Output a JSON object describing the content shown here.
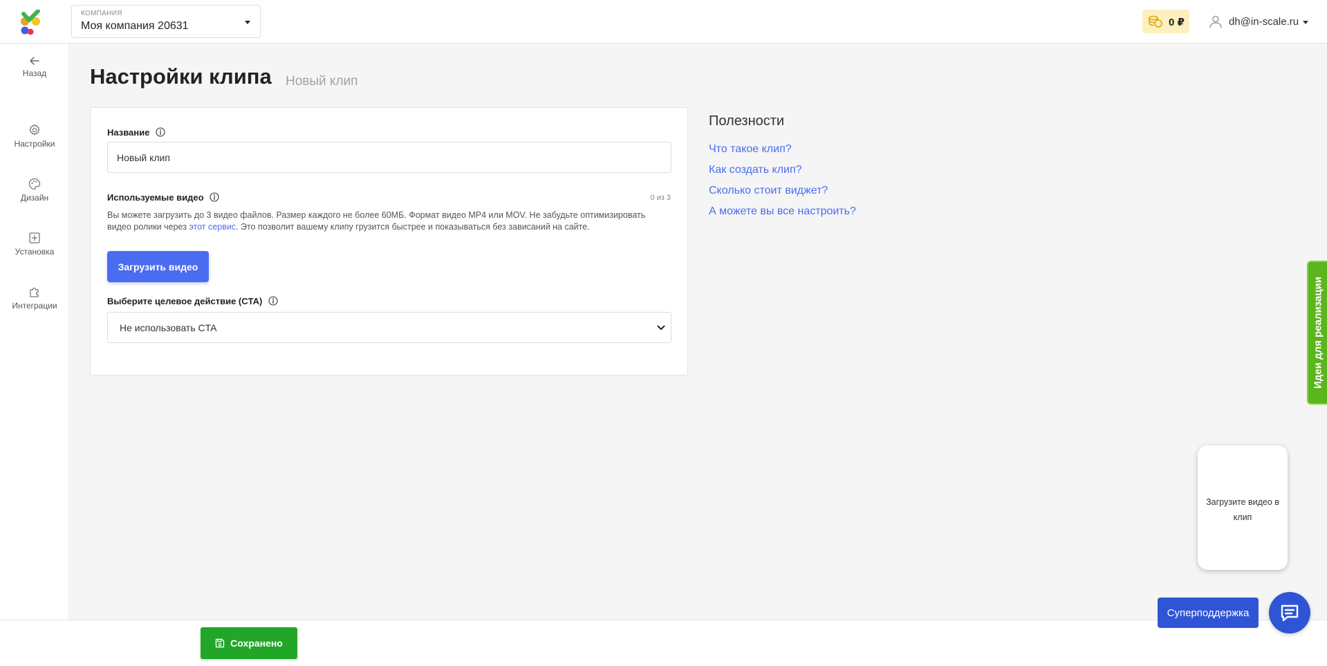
{
  "header": {
    "company_caption": "КОМПАНИЯ",
    "company_name": "Моя компания 20631",
    "balance": "0 ₽",
    "user_email": "dh@in-scale.ru"
  },
  "sidebar": {
    "items": [
      {
        "label": "Назад",
        "icon": "arrow-left-icon"
      },
      {
        "label": "Настройки",
        "icon": "gear-icon"
      },
      {
        "label": "Дизайн",
        "icon": "palette-icon"
      },
      {
        "label": "Установка",
        "icon": "plus-square-icon"
      },
      {
        "label": "Интеграции",
        "icon": "puzzle-icon"
      }
    ]
  },
  "page": {
    "title": "Настройки клипа",
    "subtitle": "Новый клип"
  },
  "form": {
    "name_label": "Название",
    "name_value": "Новый клип",
    "videos_label": "Используемые видео",
    "videos_counter": "0 из 3",
    "help_text_before": "Вы можете загрузить до 3 видео файлов. Размер каждого не более 60МБ. Формат видео MP4 или MOV. Не забудьте оптимизировать видео ролики через ",
    "help_link": "этот сервис",
    "help_text_after": ". Это позволит вашему клипу грузится быстрее и показываться без зависаний на сайте.",
    "upload_button": "Загрузить видео",
    "cta_label": "Выберите целевое действие (CTA)",
    "cta_value": "Не использовать CTA"
  },
  "useful": {
    "title": "Полезности",
    "links": [
      "Что такое клип?",
      "Как создать клип?",
      "Сколько стоит виджет?",
      "А можете вы все настроить?"
    ]
  },
  "ideas_tab": "Идеи для реализации",
  "preview_text": "Загрузите видео в клип",
  "footer": {
    "save_button": "Сохранено",
    "support_button": "Суперподдержка"
  },
  "colors": {
    "accent": "#4a6cf0",
    "save_green": "#22a628",
    "ideas_green": "#5bb51c",
    "support_blue": "#2f55d4",
    "balance_bg": "#fdf0bf"
  }
}
